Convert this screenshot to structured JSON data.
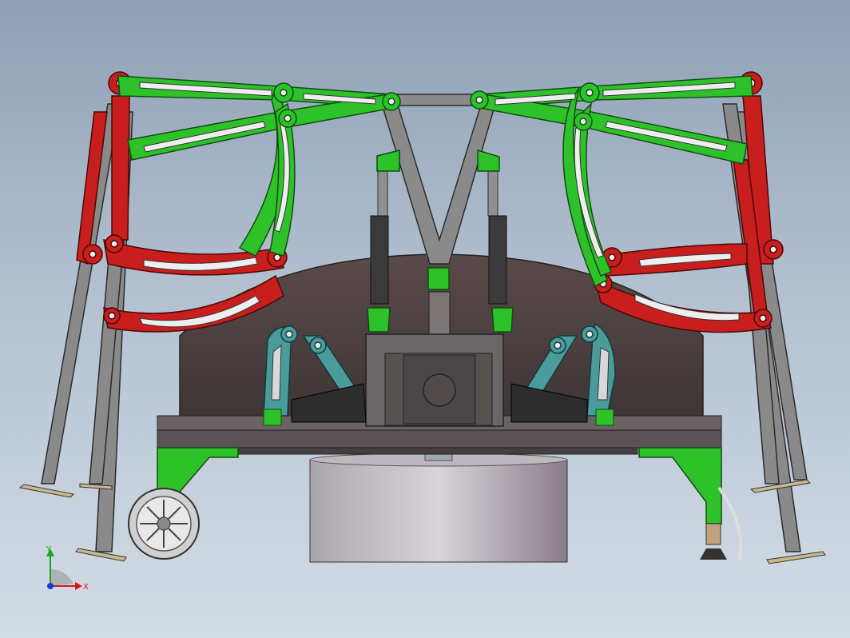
{
  "viewport": {
    "triad": {
      "x_label": "X",
      "y_label": "Y"
    }
  },
  "colors": {
    "background_top": "#8fa0b5",
    "background_bottom": "#d4dde6",
    "frame_green": "#2ec22a",
    "frame_red": "#c81e1e",
    "teal": "#4a9c9c",
    "grey_strut": "#8a8a8a",
    "dark_body": "#55484a",
    "cylinder": "#c8c4cc"
  },
  "icons": [
    "axis-triad-icon",
    "wheel-icon"
  ]
}
